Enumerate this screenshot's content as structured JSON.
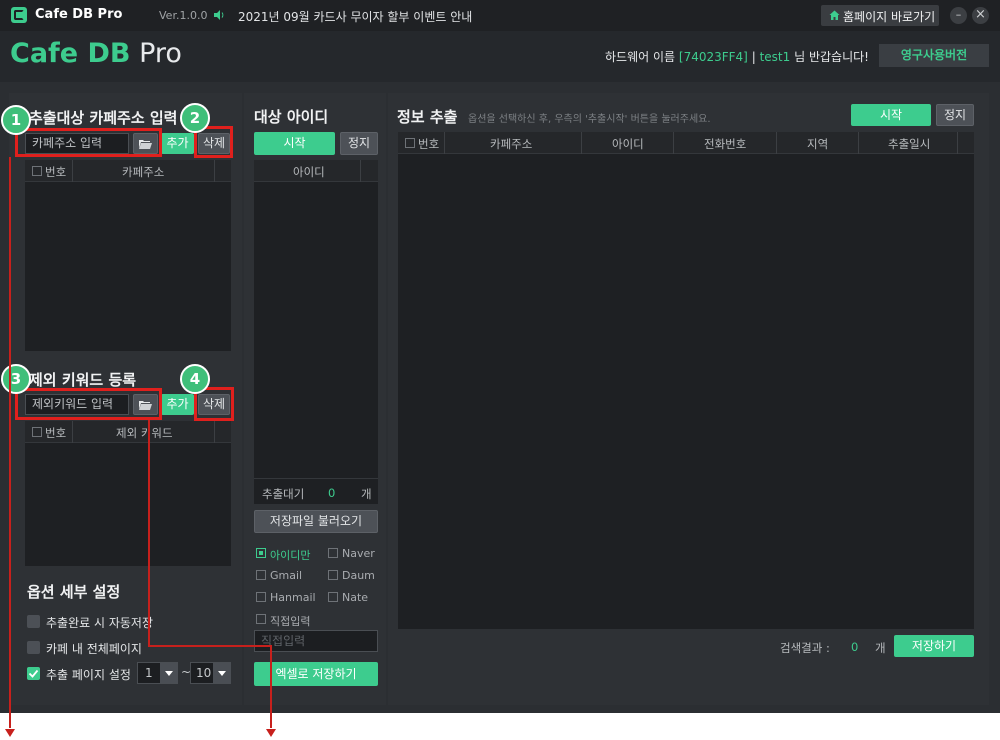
{
  "titlebar": {
    "app_name": "Cafe DB Pro",
    "version": "Ver.1.0.0",
    "notice": "2021년 09월 카드사 무이자 할부 이벤트 안내",
    "home_button": "홈페이지 바로가기",
    "minimize": "–",
    "close": "×"
  },
  "brand": {
    "logo_cafe": "Cafe",
    "logo_db": " DB",
    "logo_pro": " Pro",
    "hw_label": "하드웨어 이름",
    "hw_id": "[74023FF4]",
    "divider": "|",
    "user_id": "test1",
    "greeting": "님 반갑습니다!",
    "license_button": "영구사용버전"
  },
  "left": {
    "cafe_title": "추출대상 카페주소 입력",
    "cafe_placeholder": "카페주소 입력",
    "add": "추가",
    "delete": "삭제",
    "col_num": "번호",
    "col_cafe": "카페주소",
    "keyword_title": "제외 키워드 등록",
    "keyword_placeholder": "제외키워드 입력",
    "col_keyword": "제외 키워드",
    "options_title": "옵션 세부 설정",
    "opt_autosave": "추출완료 시 자동저장",
    "opt_allpages": "카페 내 전체페이지",
    "opt_pages": "추출 페이지 설정",
    "page_from": "1",
    "tilde": "~",
    "page_to": "10"
  },
  "middle": {
    "title": "대상 아이디",
    "start": "시작",
    "stop": "정지",
    "col_id": "아이디",
    "waiting_label": "추출대기",
    "waiting_count": "0",
    "unit": "개",
    "load_file": "저장파일 불러오기",
    "opt_id_only": "아이디만",
    "opt_naver": "Naver",
    "opt_gmail": "Gmail",
    "opt_daum": "Daum",
    "opt_hanmail": "Hanmail",
    "opt_nate": "Nate",
    "opt_direct": "직접입력",
    "direct_placeholder": "직접입력",
    "excel_save": "엑셀로 저장하기"
  },
  "right": {
    "title": "정보 추출",
    "hint": "옵션을 선택하신 후, 우측의 '추출시작' 버튼을 눌러주세요.",
    "start": "시작",
    "stop": "정지",
    "columns": [
      "번호",
      "카페주소",
      "아이디",
      "전화번호",
      "지역",
      "추출일시"
    ],
    "result_label": "검색결과 :",
    "result_count": "0",
    "unit": "개",
    "save": "저장하기"
  },
  "annotations": {
    "b1": "1",
    "b2": "2",
    "b3": "3",
    "b4": "4"
  },
  "colors": {
    "accent": "#3dcc8e",
    "annotation_red": "#e0201d",
    "background": "#2b2e32"
  }
}
